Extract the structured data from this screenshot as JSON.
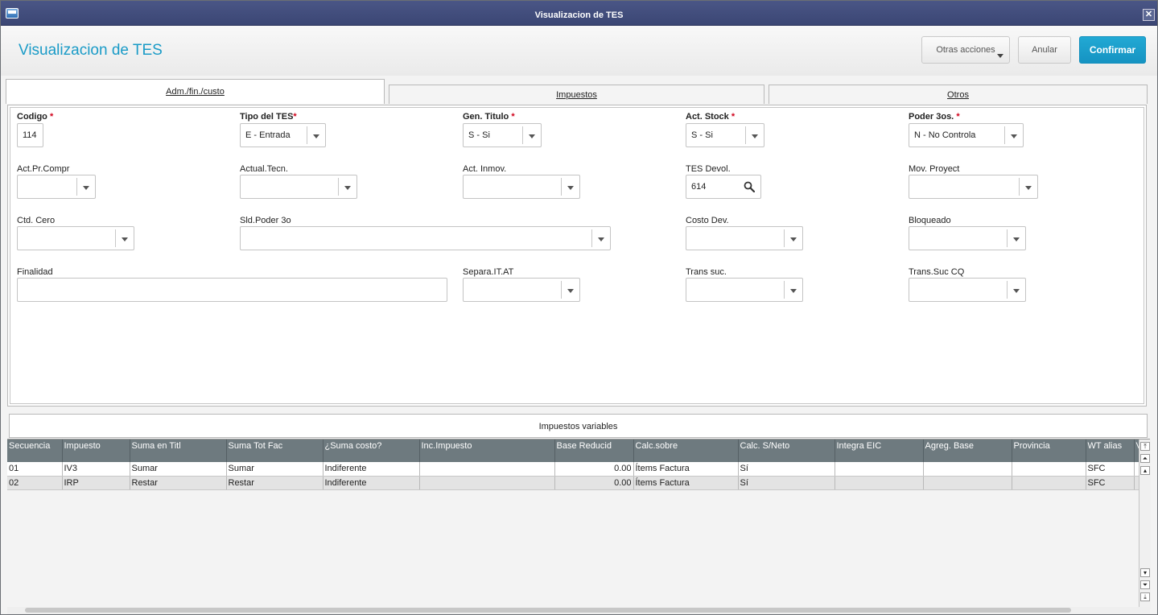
{
  "window": {
    "title": "Visualizacion de TES",
    "close_glyph": "✕"
  },
  "header": {
    "title": "Visualizacion de TES",
    "buttons": {
      "more": "Otras acciones",
      "cancel": "Anular",
      "confirm": "Confirmar"
    }
  },
  "tabs": [
    {
      "label": "Adm./fin./custo",
      "active": true
    },
    {
      "label": "Impuestos",
      "active": false
    },
    {
      "label": "Otros",
      "active": false
    }
  ],
  "form": {
    "codigo": {
      "label": "Codigo",
      "value": "114",
      "required": true
    },
    "tipo_tes": {
      "label": "Tipo del TES",
      "value": "E - Entrada",
      "required": true
    },
    "gen_titulo": {
      "label": "Gen. Titulo",
      "value": "S - Si",
      "required": true
    },
    "act_stock": {
      "label": "Act. Stock",
      "value": "S - Si",
      "required": true
    },
    "poder_3os": {
      "label": "Poder 3os.",
      "value": "N - No Controla",
      "required": true
    },
    "act_pr_compr": {
      "label": "Act.Pr.Compr",
      "value": ""
    },
    "actual_tecn": {
      "label": "Actual.Tecn.",
      "value": ""
    },
    "act_inmov": {
      "label": "Act. Inmov.",
      "value": ""
    },
    "tes_devol": {
      "label": "TES Devol.",
      "value": "614"
    },
    "mov_proyect": {
      "label": "Mov. Proyect",
      "value": ""
    },
    "ctd_cero": {
      "label": "Ctd. Cero",
      "value": ""
    },
    "sld_poder": {
      "label": "Sld.Poder 3o",
      "value": ""
    },
    "costo_dev": {
      "label": "Costo Dev.",
      "value": ""
    },
    "bloqueado": {
      "label": "Bloqueado",
      "value": ""
    },
    "finalidad": {
      "label": "Finalidad",
      "value": ""
    },
    "separa_it": {
      "label": "Separa.IT.AT",
      "value": ""
    },
    "trans_suc": {
      "label": "Trans suc.",
      "value": ""
    },
    "trans_suc_cq": {
      "label": "Trans.Suc CQ",
      "value": ""
    }
  },
  "grid": {
    "title": "Impuestos variables",
    "columns": [
      "Secuencia",
      "Impuesto",
      "Suma en Titl",
      "Suma Tot Fac",
      "¿Suma costo?",
      "Inc.Impuesto",
      "Base Reducid",
      "Calc.sobre",
      "Calc. S/Neto",
      "Integra EIC",
      "Agreg. Base",
      "Provincia",
      "WT alias",
      "V"
    ],
    "rows": [
      [
        "01",
        "IV3",
        "Sumar",
        "Sumar",
        "Indiferente",
        "",
        "0.00",
        "Ítems Factura",
        "Sí",
        "",
        "",
        "",
        "SFC",
        ""
      ],
      [
        "02",
        "IRP",
        "Restar",
        "Restar",
        "Indiferente",
        "",
        "0.00",
        "Ítems Factura",
        "Sí",
        "",
        "",
        "",
        "SFC",
        ""
      ]
    ]
  },
  "required_marker": "*",
  "colors": {
    "accent": "#1a9bc7",
    "titlebar": "#3f4a79",
    "confirm": "#1a9ecb",
    "required": "#d0021b"
  }
}
